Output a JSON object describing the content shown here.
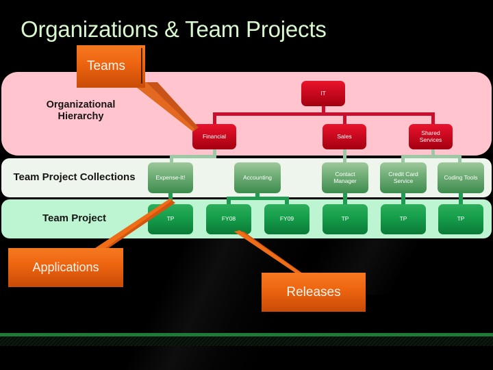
{
  "slide": {
    "title": "Organizations & Team Projects",
    "background_color": "#000000",
    "title_color": "#d9f7cf"
  },
  "bands": [
    {
      "key": "org",
      "label": "Organizational\nHierarchy",
      "label_line1": "Organizational",
      "label_line2": "Hierarchy",
      "color": "#ffc4cd"
    },
    {
      "key": "tpc",
      "label": "Team Project Collections",
      "color": "#eef5ec"
    },
    {
      "key": "tp",
      "label": "Team Project",
      "color": "#bdf5d2"
    }
  ],
  "org_hierarchy": {
    "root": {
      "label": "IT",
      "color": "#c8102e"
    },
    "children": [
      {
        "label": "Financial",
        "color": "#c8102e"
      },
      {
        "label": "Sales",
        "color": "#c8102e"
      },
      {
        "label": "Shared\nServices",
        "line1": "Shared",
        "line2": "Services",
        "color": "#c8102e"
      }
    ]
  },
  "team_project_collections": [
    {
      "label": "Expense-It!"
    },
    {
      "label": "Accounting"
    },
    {
      "label": "Contact\nManager",
      "line1": "Contact",
      "line2": "Manager"
    },
    {
      "label": "Credit Card\nService",
      "line1": "Credit Card",
      "line2": "Service"
    },
    {
      "label": "Coding Tools"
    }
  ],
  "team_projects": [
    {
      "label": "TP"
    },
    {
      "label": "FY08"
    },
    {
      "label": "FY09"
    },
    {
      "label": "TP"
    },
    {
      "label": "TP"
    },
    {
      "label": "TP"
    }
  ],
  "callouts": [
    {
      "key": "teams",
      "label": "Teams",
      "color": "#ef6611"
    },
    {
      "key": "applications",
      "label": "Applications",
      "color": "#ef6611"
    },
    {
      "key": "releases",
      "label": "Releases",
      "color": "#ef6611"
    }
  ],
  "footer": {
    "rule_color": "#1d7a38"
  }
}
